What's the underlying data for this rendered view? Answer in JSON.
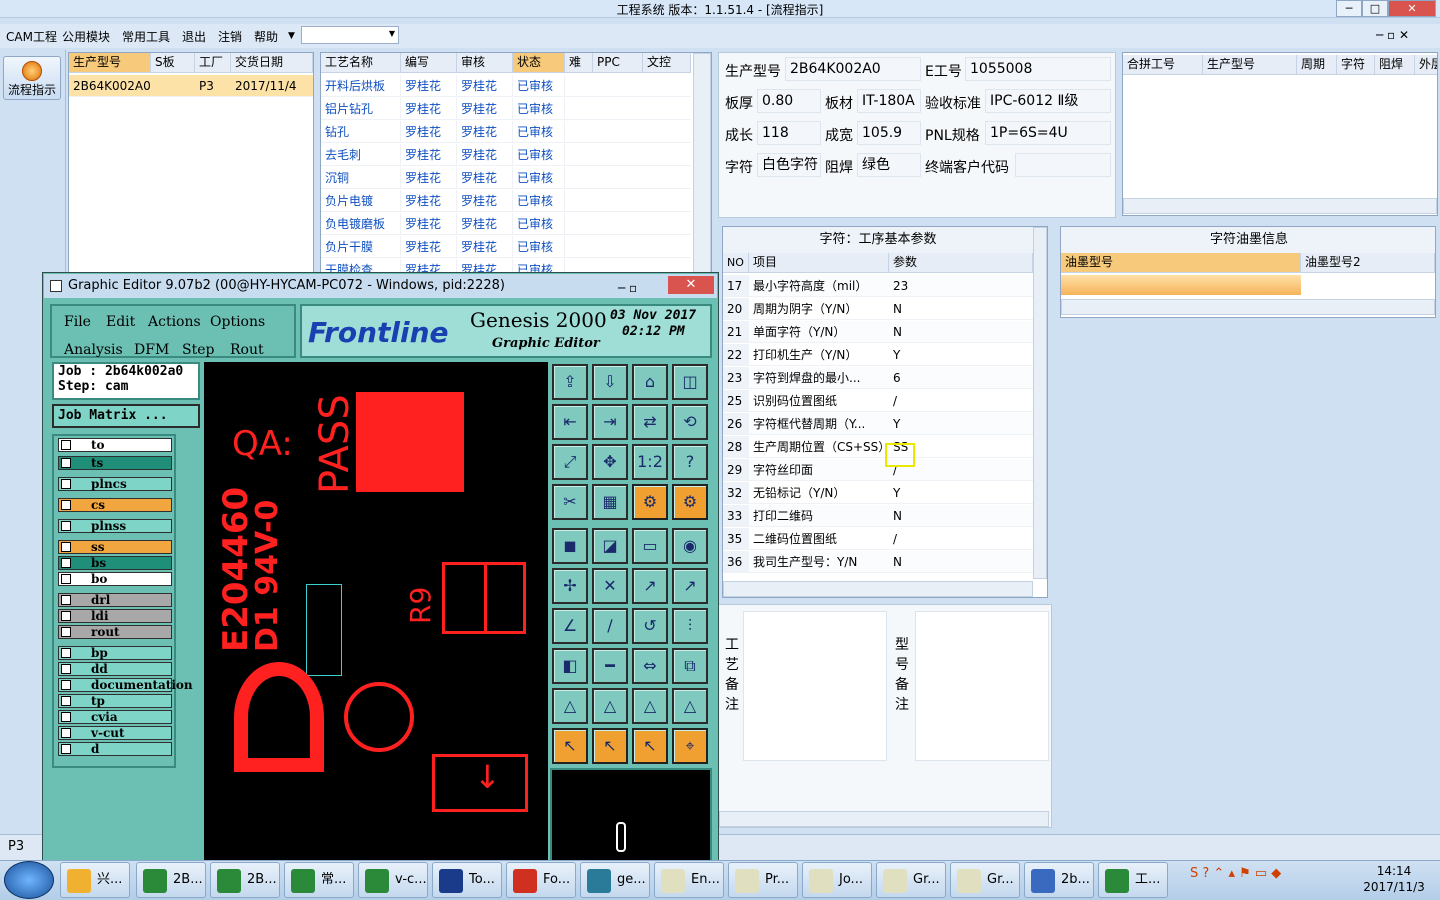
{
  "window": {
    "title": "工程系统   版本：1.1.51.4 - [流程指示]"
  },
  "menu": [
    "CAM工程",
    "公用模块",
    "常用工具",
    "退出",
    "注销",
    "帮助"
  ],
  "sidebar": {
    "flow_button": "流程指示",
    "status": "P3"
  },
  "orders": {
    "headers": [
      "生产型号",
      "S板",
      "工厂",
      "交货日期"
    ],
    "rows": [
      [
        "2B64K002A0",
        "",
        "P3",
        "2017/11/4"
      ]
    ]
  },
  "process": {
    "headers": [
      "工艺名称",
      "编写",
      "审核",
      "状态",
      "难",
      "PPC",
      "文控"
    ],
    "rows": [
      [
        "开料后烘板",
        "罗桂花",
        "罗桂花",
        "已审核"
      ],
      [
        "铝片钻孔",
        "罗桂花",
        "罗桂花",
        "已审核"
      ],
      [
        "钻孔",
        "罗桂花",
        "罗桂花",
        "已审核"
      ],
      [
        "去毛刺",
        "罗桂花",
        "罗桂花",
        "已审核"
      ],
      [
        "沉铜",
        "罗桂花",
        "罗桂花",
        "已审核"
      ],
      [
        "负片电镀",
        "罗桂花",
        "罗桂花",
        "已审核"
      ],
      [
        "负电镀磨板",
        "罗桂花",
        "罗桂花",
        "已审核"
      ],
      [
        "负片干膜",
        "罗桂花",
        "罗桂花",
        "已审核"
      ],
      [
        "干膜检查",
        "罗桂花",
        "罗桂花",
        "已审核"
      ]
    ]
  },
  "info": {
    "labels": {
      "model": "生产型号",
      "eno": "E工号",
      "thick": "板厚",
      "material": "板材",
      "standard": "验收标准",
      "len": "成长",
      "wid": "成宽",
      "pnl": "PNL规格",
      "char": "字符",
      "mask": "阻焊",
      "cust": "终端客户代码"
    },
    "values": {
      "model": "2B64K002A0",
      "eno": "1055008",
      "thick": "0.80",
      "material": "IT-180A",
      "standard": "IPC-6012 Ⅱ级",
      "len": "118",
      "wid": "105.9",
      "pnl": "1P=6S=4U",
      "char": "白色字符",
      "mask": "绿色",
      "cust": ""
    }
  },
  "combine": {
    "headers": [
      "合拼工号",
      "生产型号",
      "周期",
      "字符",
      "阻焊",
      "外层"
    ]
  },
  "params": {
    "title": "字符：工序基本参数",
    "headers": [
      "NO",
      "项目",
      "参数"
    ],
    "rows": [
      [
        "17",
        "最小字符高度（mil）",
        "23"
      ],
      [
        "20",
        "周期为阴字（Y/N）",
        "N"
      ],
      [
        "21",
        "单面字符（Y/N）",
        "N"
      ],
      [
        "22",
        "打印机生产（Y/N）",
        "Y"
      ],
      [
        "23",
        "字符到焊盘的最小...",
        "6"
      ],
      [
        "25",
        "识别码位置图纸",
        "/"
      ],
      [
        "26",
        "字符框代替周期（Y...",
        "Y"
      ],
      [
        "28",
        "生产周期位置（CS+SS）",
        "SS"
      ],
      [
        "29",
        "字符丝印面",
        "/"
      ],
      [
        "32",
        "无铅标记（Y/N）",
        "Y"
      ],
      [
        "33",
        "打印二维码",
        "N"
      ],
      [
        "35",
        "二维码位置图纸",
        "/"
      ],
      [
        "36",
        "我司生产型号：Y/N",
        "N"
      ]
    ]
  },
  "ink": {
    "title": "字符油墨信息",
    "headers": [
      "油墨型号",
      "油墨型号2"
    ]
  },
  "notes": {
    "process": "工艺备注",
    "model": "型号备注"
  },
  "ge": {
    "title": "Graphic Editor 9.07b2 (00@HY-HYCAM-PC072 - Windows, pid:2228)",
    "menu": [
      "File",
      "Edit",
      "Actions",
      "Options",
      "Analysis",
      "DFM",
      "Step",
      "Rout"
    ],
    "brand": "Frontline",
    "product": "Genesis 2000",
    "sub": "Graphic Editor",
    "date": "03  Nov  2017",
    "time": "02:12  PM",
    "job": "Job :  2b64k002a0",
    "step": "Step:  cam",
    "matrix": "Job Matrix ...",
    "layers": [
      {
        "n": "to",
        "c": "#ffffff"
      },
      {
        "n": "ts",
        "c": "#1f8f7a"
      },
      {
        "n": "plncs",
        "c": "#7fd4c8"
      },
      {
        "n": "cs",
        "c": "#f2a640"
      },
      {
        "n": "plnss",
        "c": "#7fd4c8"
      },
      {
        "n": "ss",
        "c": "#f2a640"
      },
      {
        "n": "bs",
        "c": "#1f8f7a"
      },
      {
        "n": "bo",
        "c": "#ffffff"
      },
      {
        "n": "drl",
        "c": "#a8a8a8"
      },
      {
        "n": "ldi",
        "c": "#a8a8a8"
      },
      {
        "n": "rout",
        "c": "#a8a8a8"
      },
      {
        "n": "bp",
        "c": "#7fd4c8"
      },
      {
        "n": "dd",
        "c": "#7fd4c8"
      },
      {
        "n": "documentation",
        "c": "#7fd4c8"
      },
      {
        "n": "tp",
        "c": "#7fd4c8"
      },
      {
        "n": "cvia",
        "c": "#7fd4c8"
      },
      {
        "n": "v-cut",
        "c": "#7fd4c8"
      },
      {
        "n": "d",
        "c": "#7fd4c8"
      }
    ],
    "canvas_text": {
      "qa": "QA:",
      "pass": "PASS",
      "code": "E204460",
      "rating": "D1 94V-0",
      "ref": "R9"
    }
  },
  "taskbar": {
    "items": [
      "兴...",
      "2B...",
      "2B...",
      "常...",
      "v-c...",
      "To...",
      "Fo...",
      "ge...",
      "En...",
      "Pr...",
      "Jo...",
      "Gr...",
      "Gr...",
      "2b...",
      "工..."
    ],
    "time": "14:14",
    "date": "2017/11/3"
  }
}
